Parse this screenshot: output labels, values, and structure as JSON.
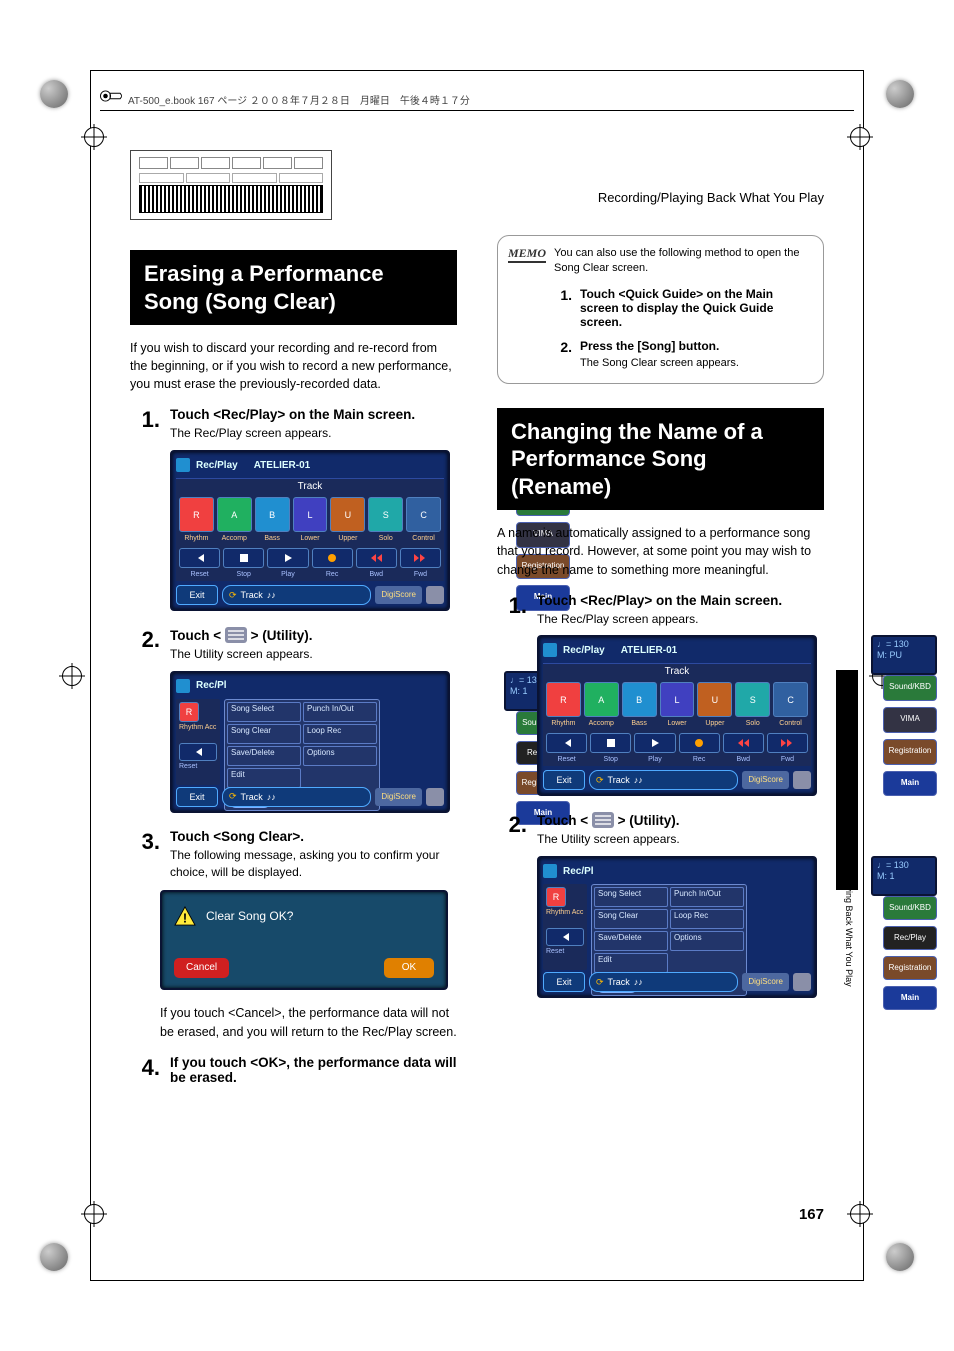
{
  "print_header": "AT-500_e.book  167 ページ  ２００８年７月２８日　月曜日　午後４時１７分",
  "header_right": "Recording/Playing Back What You Play",
  "page_number": "167",
  "side_tab_text": "Recording/Playing Back What You Play",
  "sectionA": {
    "title": "Erasing a Performance Song (Song Clear)",
    "intro": "If you wish to discard your recording and re-record from the beginning, or if you wish to record a new performance, you must erase the previously-recorded data.",
    "steps": {
      "s1": {
        "num": "1.",
        "head": "Touch <Rec/Play> on the Main screen.",
        "sub": "The Rec/Play screen appears."
      },
      "s2": {
        "num": "2.",
        "head_pre": "Touch < ",
        "head_post": " > (Utility).",
        "sub": "The Utility screen appears."
      },
      "s3": {
        "num": "3.",
        "head": "Touch <Song Clear>.",
        "sub": "The following message, asking you to confirm your choice, will be displayed."
      },
      "s3b": "If you touch <Cancel>, the performance data will not be erased, and you will return to the Rec/Play screen.",
      "s4": {
        "num": "4.",
        "head": "If you touch <OK>, the performance data will be erased."
      }
    }
  },
  "memo": {
    "tag": "MEMO",
    "intro": "You can also use the following method to open the Song Clear screen.",
    "s1": {
      "num": "1.",
      "head": "Touch <Quick Guide> on the Main screen to display the Quick Guide screen."
    },
    "s2": {
      "num": "2.",
      "head": "Press the [Song] button.",
      "sub": "The Song Clear screen appears."
    }
  },
  "sectionB": {
    "title": "Changing the Name of a Performance Song (Rename)",
    "intro": "A name is automatically assigned to a performance song that you record. However, at some point you may wish to change the name to something more meaningful.",
    "steps": {
      "s1": {
        "num": "1.",
        "head": "Touch <Rec/Play> on the Main screen.",
        "sub": "The Rec/Play screen appears."
      },
      "s2": {
        "num": "2.",
        "head_pre": "Touch < ",
        "head_post": " > (Utility).",
        "sub": "The Utility screen appears."
      }
    }
  },
  "screen": {
    "title_prefix": "Rec/Play",
    "song_name": "ATELIER-01",
    "tempo_top": "♩= 130",
    "tempo_bot": "M:   PU",
    "tempo_bot_alt": "M:    1",
    "track_header": "Track",
    "slots": {
      "r": "R",
      "a": "A",
      "b": "B",
      "l": "L",
      "u": "U",
      "s": "S",
      "c": "C"
    },
    "slot_labels": {
      "r": "Rhythm",
      "a": "Accomp",
      "b": "Bass",
      "l": "Lower",
      "u": "Upper",
      "s": "Solo",
      "c": "Control"
    },
    "transport": {
      "reset": "Reset",
      "stop": "Stop",
      "play": "Play",
      "rec": "Rec",
      "bwd": "Bwd",
      "fwd": "Fwd"
    },
    "side": {
      "sound": "Sound/KBD",
      "vima": "VIMA",
      "recplay": "Rec/Play",
      "reg": "Registration",
      "main": "Main"
    },
    "exit": "Exit",
    "track_pill": "Track",
    "digi": "DigiScore",
    "util": {
      "song_select": "Song Select",
      "punch": "Punch In/Out",
      "song_clear": "Song Clear",
      "loop": "Loop Rec",
      "save": "Save/Delete",
      "options": "Options",
      "edit": "Edit",
      "exit": "Exit"
    },
    "rec_pl_short": "Rec/Pl"
  },
  "confirm": {
    "question": "Clear Song OK?",
    "cancel": "Cancel",
    "ok": "OK"
  }
}
